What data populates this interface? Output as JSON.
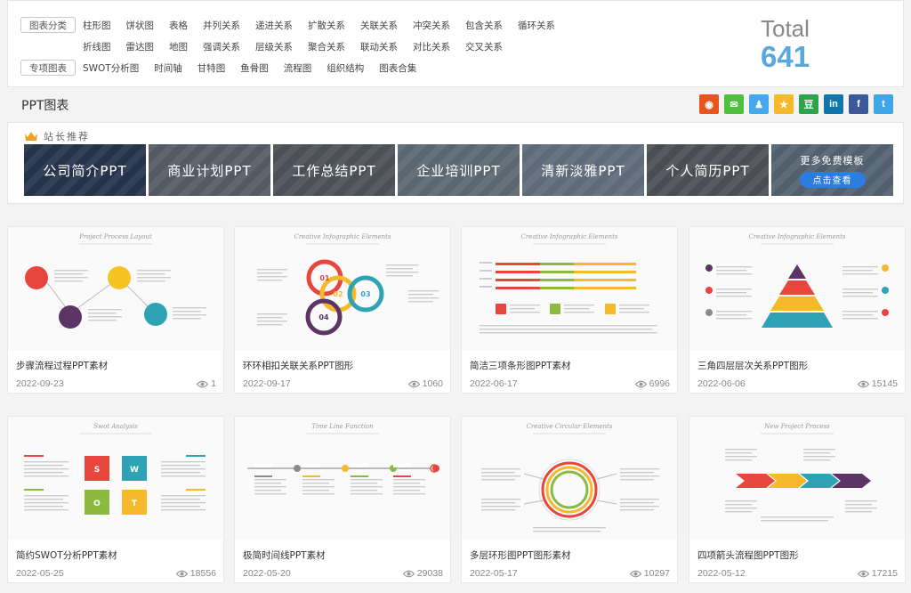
{
  "categories": {
    "row1": {
      "tag": "图表分类",
      "links": [
        "柱形图",
        "饼状图",
        "表格",
        "并列关系",
        "递进关系",
        "扩散关系",
        "关联关系",
        "冲突关系",
        "包含关系",
        "循环关系"
      ]
    },
    "row2": {
      "links": [
        "折线图",
        "雷达图",
        "地图",
        "强调关系",
        "层级关系",
        "聚合关系",
        "联动关系",
        "对比关系",
        "交叉关系"
      ]
    },
    "row3": {
      "tag": "专项图表",
      "links": [
        "SWOT分析图",
        "时间轴",
        "甘特图",
        "鱼骨图",
        "流程图",
        "组织结构",
        "图表合集"
      ]
    }
  },
  "total": {
    "label": "Total",
    "value": "641"
  },
  "section_title": "PPT图表",
  "share": [
    {
      "icon": "weibo-icon",
      "glyph": "◉",
      "color": "#e8541e"
    },
    {
      "icon": "wechat-icon",
      "glyph": "✉",
      "color": "#4fbf40"
    },
    {
      "icon": "qq-icon",
      "glyph": "♟",
      "color": "#43a9ec"
    },
    {
      "icon": "qzone-icon",
      "glyph": "★",
      "color": "#f5b92b"
    },
    {
      "icon": "douban-icon",
      "glyph": "豆",
      "color": "#2ea34b"
    },
    {
      "icon": "linkedin-icon",
      "glyph": "in",
      "color": "#0e76a8"
    },
    {
      "icon": "facebook-icon",
      "glyph": "f",
      "color": "#3b5998"
    },
    {
      "icon": "twitter-icon",
      "glyph": "t",
      "color": "#3fa6e8"
    }
  ],
  "recommend": {
    "title": "站长推荐",
    "tiles": [
      {
        "label": "公司简介PPT",
        "color": "#24324a"
      },
      {
        "label": "商业计划PPT",
        "color": "#545a64"
      },
      {
        "label": "工作总结PPT",
        "color": "#4b4f56"
      },
      {
        "label": "企业培训PPT",
        "color": "#5a6670"
      },
      {
        "label": "清新淡雅PPT",
        "color": "#5e6a78"
      },
      {
        "label": "个人简历PPT",
        "color": "#4a4d53"
      }
    ],
    "more": {
      "text": "更多免费模板",
      "button": "点击查看",
      "color": "#52606e"
    }
  },
  "cards": [
    {
      "title": "步骤流程过程PPT素材",
      "date": "2022-09-23",
      "views": "1",
      "thumb_heading": "Project Process Layout"
    },
    {
      "title": "环环相扣关联关系PPT图形",
      "date": "2022-09-17",
      "views": "1060",
      "thumb_heading": "Creative Infographic Elements"
    },
    {
      "title": "简洁三项条形图PPT素材",
      "date": "2022-06-17",
      "views": "6996",
      "thumb_heading": "Creative Infographic Elements"
    },
    {
      "title": "三角四层层次关系PPT图形",
      "date": "2022-06-06",
      "views": "15145",
      "thumb_heading": "Creative Infographic Elements"
    },
    {
      "title": "简约SWOT分析PPT素材",
      "date": "2022-05-25",
      "views": "18556",
      "thumb_heading": "Swot Analysis"
    },
    {
      "title": "极简时间线PPT素材",
      "date": "2022-05-20",
      "views": "29038",
      "thumb_heading": "Time Line Function"
    },
    {
      "title": "多层环形图PPT图形素材",
      "date": "2022-05-17",
      "views": "10297",
      "thumb_heading": "Creative Circular Elements"
    },
    {
      "title": "四项箭头流程图PPT图形",
      "date": "2022-05-12",
      "views": "17215",
      "thumb_heading": "New Project Process"
    }
  ]
}
